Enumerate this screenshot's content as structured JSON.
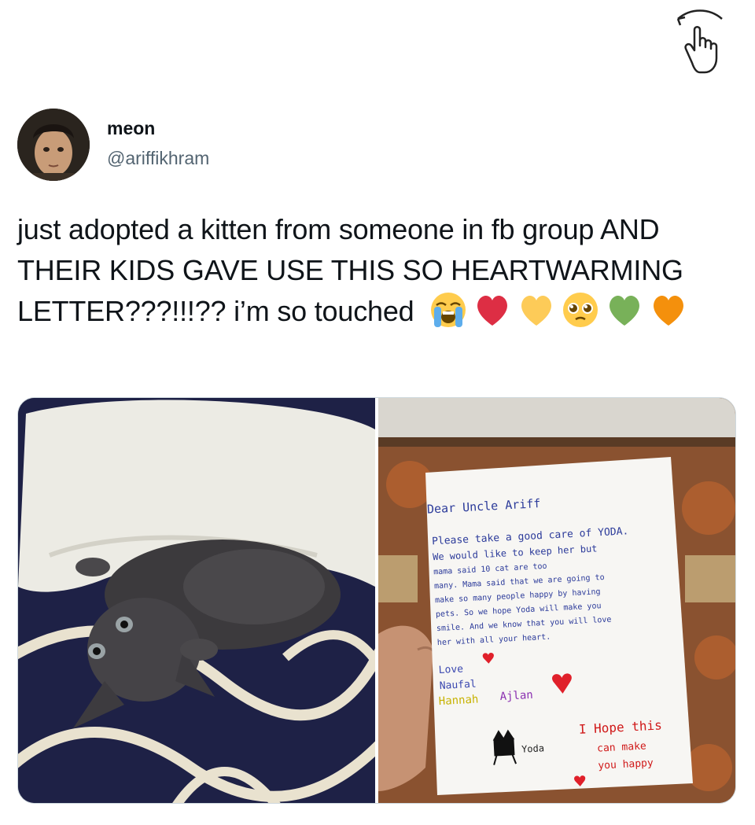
{
  "header": {
    "gesture_icon": "tap-hand-icon"
  },
  "tweet": {
    "author_name": "meon",
    "author_handle": "@ariffikhram",
    "text": "just adopted a kitten from someone in fb group AND THEIR KIDS GAVE USE THIS SO HEARTWARMING LETTER???!!!?? i’m so touched",
    "emojis": [
      "loudly-crying-face-icon",
      "red-heart-icon",
      "yellow-heart-icon",
      "pleading-face-icon",
      "green-heart-icon",
      "orange-heart-icon"
    ]
  },
  "media": {
    "left_photo": "kitten-photo",
    "right_photo": "handwritten-letter-photo",
    "letter": {
      "greeting": "Dear Uncle Ariff",
      "lines": [
        "Please take a good care of YODA.",
        "We would like to keep her but",
        "mama said 10 cat are too",
        "many. Mama said that we are going to",
        "make so many people happy by having",
        "pets. So we hope Yoda will make you",
        "smile. And we know that you will love",
        "her with all your heart."
      ],
      "closing": "Love",
      "signature_1": "Naufal",
      "signature_2": "Hannah",
      "signature_3": "Ajlan",
      "cat_label": "Yoda",
      "ps_1": "I Hope this",
      "ps_2": "can make",
      "ps_3": "you happy"
    }
  }
}
